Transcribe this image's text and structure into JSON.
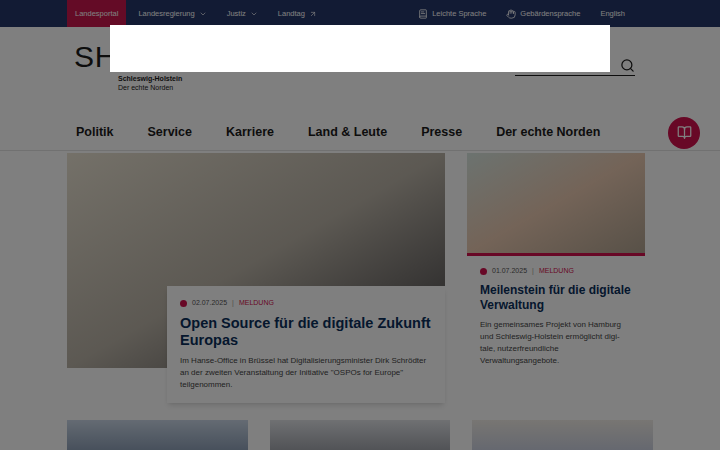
{
  "topbar": {
    "items": [
      {
        "label": "Landesportal",
        "selected": true,
        "kind": "link"
      },
      {
        "label": "Landesregierung",
        "selected": false,
        "kind": "dropdown"
      },
      {
        "label": "Justiz",
        "selected": false,
        "kind": "dropdown"
      },
      {
        "label": "Landtag",
        "selected": false,
        "kind": "external"
      }
    ],
    "tools": [
      {
        "label": "Leichte Sprache",
        "kind": "easy"
      },
      {
        "label": "Gebärdensprache",
        "kind": "sign"
      },
      {
        "label": "English",
        "kind": "plain"
      }
    ]
  },
  "logo": {
    "mark": "SH",
    "name": "Schleswig-Holstein",
    "claim": "Der echte Norden"
  },
  "nav": {
    "items": [
      "Politik",
      "Service",
      "Karriere",
      "Land & Leute",
      "Presse",
      "Der echte Norden"
    ]
  },
  "teasers": [
    {
      "date": "02.07.2025",
      "separator": "|",
      "type": "MELDUNG",
      "title": "Open Source für die digitale Zukunft Europas",
      "text": "Im Hanse-Office in Brüssel hat Digitalisierungsminister Dirk Schröd­ter an der zweiten Veranstaltung der Initiative \"OSPOs for Europe\" teilgenommen."
    },
    {
      "date": "01.07.2025",
      "separator": "|",
      "type": "MELDUNG",
      "title": "Meilenstein für die digitale Verwaltung",
      "text": "Ein gemeinsames Projekt von Hamburg und Schleswig-Holstein ermöglicht digi­tale, nutzerfreundliche Verwaltungsangebote."
    }
  ],
  "overlay": {
    "visible": true
  }
}
